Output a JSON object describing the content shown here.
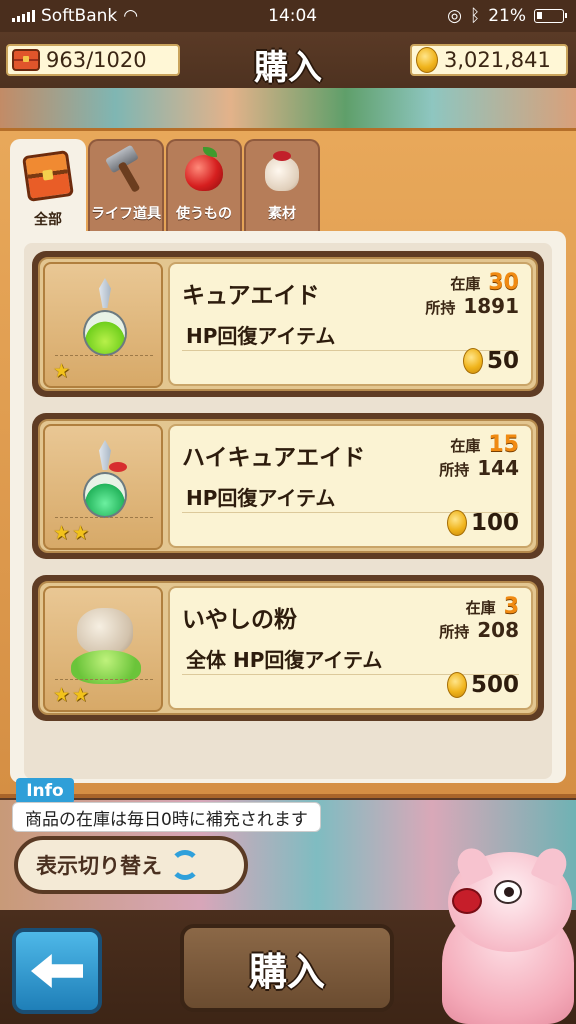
{
  "status_bar": {
    "carrier": "SoftBank",
    "time": "14:04",
    "battery": "21%"
  },
  "header": {
    "title": "購入",
    "stamina": "963/1020",
    "coins": "3,021,841"
  },
  "tabs": [
    {
      "label": "全部",
      "icon": "chest-icon",
      "active": true
    },
    {
      "label": "ライフ道具",
      "icon": "hammer-icon",
      "active": false
    },
    {
      "label": "使うもの",
      "icon": "apple-icon",
      "active": false
    },
    {
      "label": "素材",
      "icon": "sack-icon",
      "active": false
    }
  ],
  "labels": {
    "stock": "在庫",
    "owned": "所持"
  },
  "items": [
    {
      "name": "キュアエイド",
      "description": "HP回復アイテム",
      "stock": "30",
      "owned": "1891",
      "price": "50",
      "stars": 1,
      "icon": "green-potion-icon"
    },
    {
      "name": "ハイキュアエイド",
      "description": "HP回復アイテム",
      "stock": "15",
      "owned": "144",
      "price": "100",
      "stars": 2,
      "icon": "emerald-potion-icon"
    },
    {
      "name": "いやしの粉",
      "description": "全体 HP回復アイテム",
      "stock": "3",
      "owned": "208",
      "price": "500",
      "stars": 2,
      "icon": "healing-powder-icon"
    }
  ],
  "info": {
    "tag": "Info",
    "text": "商品の在庫は毎日0時に補充されます"
  },
  "buttons": {
    "toggle_view": "表示切り替え",
    "buy": "購入"
  },
  "colors": {
    "stock_accent": "#f08a12",
    "panel": "#e8a85a",
    "info_blue": "#2f9fd8",
    "star": "#f2c21b"
  }
}
